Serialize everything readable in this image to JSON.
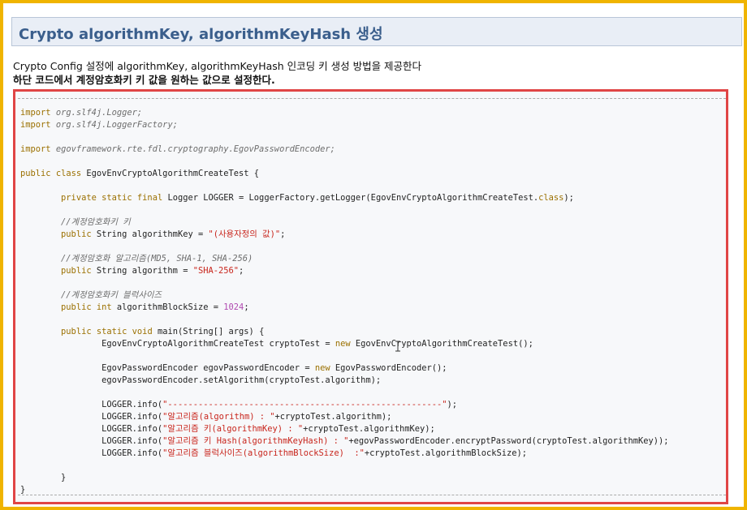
{
  "page": {
    "title": "Crypto algorithmKey, algorithmKeyHash 생성",
    "description": "Crypto Config 설정에 algorithmKey, algorithmKeyHash 인코딩 키 생성 방법을 제공한다",
    "note": "하단 코드에서 계정암호화키 키 값을 원하는 값으로 설정한다."
  },
  "code_lines": [
    "import org.slf4j.Logger;",
    "import org.slf4j.LoggerFactory;",
    "",
    "import egovframework.rte.fdl.cryptography.EgovPasswordEncoder;",
    "",
    "public class EgovEnvCryptoAlgorithmCreateTest {",
    "",
    "        private static final Logger LOGGER = LoggerFactory.getLogger(EgovEnvCryptoAlgorithmCreateTest.class);",
    "",
    "        //계정암호화키 키",
    "        public String algorithmKey = \"(사용자정의 값)\";",
    "",
    "        //계정암호화 알고리즘(MD5, SHA-1, SHA-256)",
    "        public String algorithm = \"SHA-256\";",
    "",
    "        //계정암호화키 블럭사이즈",
    "        public int algorithmBlockSize = 1024;",
    "",
    "        public static void main(String[] args) {",
    "                EgovEnvCryptoAlgorithmCreateTest cryptoTest = new EgovEnvCryptoAlgorithmCreateTest();",
    "",
    "                EgovPasswordEncoder egovPasswordEncoder = new EgovPasswordEncoder();",
    "                egovPasswordEncoder.setAlgorithm(cryptoTest.algorithm);",
    "",
    "                LOGGER.info(\"------------------------------------------------------\");",
    "                LOGGER.info(\"알고리즘(algorithm) : \"+cryptoTest.algorithm);",
    "                LOGGER.info(\"알고리즘 키(algorithmKey) : \"+cryptoTest.algorithmKey);",
    "                LOGGER.info(\"알고리즘 키 Hash(algorithmKeyHash) : \"+egovPasswordEncoder.encryptPassword(cryptoTest.algorithmKey));",
    "                LOGGER.info(\"알고리즘 블럭사이즈(algorithmBlockSize)  :\"+cryptoTest.algorithmBlockSize);",
    "",
    "        }",
    "}"
  ],
  "cursor": {
    "icon": "text-cursor-icon"
  }
}
